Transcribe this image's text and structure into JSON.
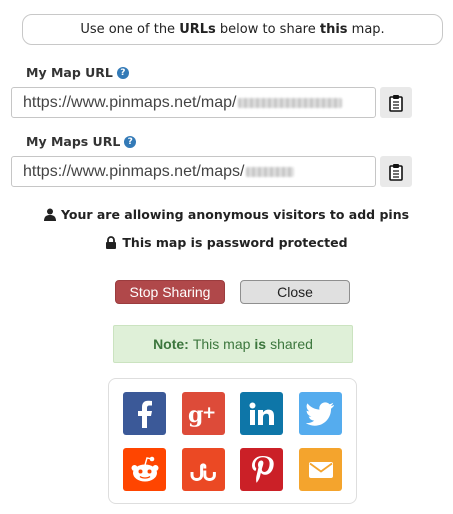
{
  "info": {
    "pre": "Use one of the ",
    "urls_word": "URLs",
    "mid": " below to share ",
    "this_word": "this",
    "post": " map."
  },
  "map_url": {
    "label": "My Map URL",
    "help_icon": "question-circle-icon",
    "value": "https://www.pinmaps.net/map/",
    "copy_icon": "clipboard-icon"
  },
  "maps_url": {
    "label": "My Maps URL",
    "help_icon": "question-circle-icon",
    "value": "https://www.pinmaps.net/maps/",
    "copy_icon": "clipboard-icon"
  },
  "notices": {
    "anonymous": "Your are allowing anonymous visitors to add pins",
    "anonymous_icon": "user-icon",
    "password": "This map is password protected",
    "password_icon": "lock-icon"
  },
  "buttons": {
    "stop": "Stop Sharing",
    "close": "Close"
  },
  "note": {
    "label": "Note:",
    "pre": "This map",
    "is_word": "is",
    "post": "shared"
  },
  "social": [
    {
      "name": "facebook",
      "icon": "facebook-icon",
      "color": "#3b5998"
    },
    {
      "name": "google-plus",
      "icon": "google-plus-icon",
      "color": "#dd4b39"
    },
    {
      "name": "linkedin",
      "icon": "linkedin-icon",
      "color": "#0e76a8"
    },
    {
      "name": "twitter",
      "icon": "twitter-icon",
      "color": "#55acee"
    },
    {
      "name": "reddit",
      "icon": "reddit-icon",
      "color": "#ff4500"
    },
    {
      "name": "stumbleupon",
      "icon": "stumbleupon-icon",
      "color": "#eb4924"
    },
    {
      "name": "pinterest",
      "icon": "pinterest-icon",
      "color": "#cb2027"
    },
    {
      "name": "email",
      "icon": "email-icon",
      "color": "#f4a42d"
    }
  ]
}
